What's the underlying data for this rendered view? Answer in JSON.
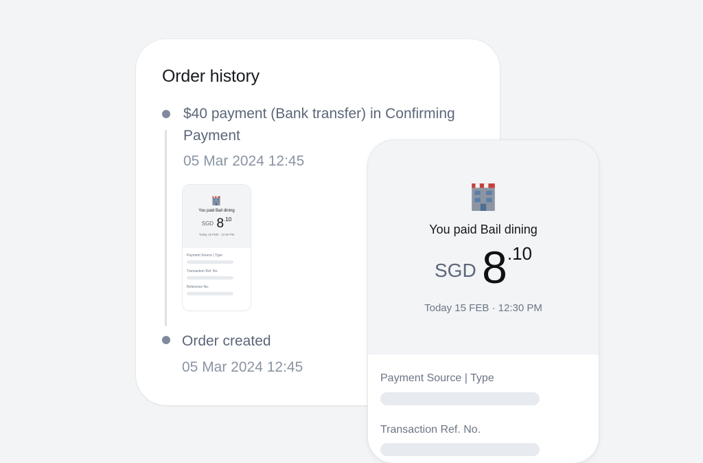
{
  "order_history": {
    "title": "Order history",
    "events": [
      {
        "title_line1": "$40 payment (Bank transfer) in Confirming",
        "title_line2": "Payment",
        "date": "05 Mar 2024 12:45"
      },
      {
        "title_line1": "Order created",
        "date": "05 Mar 2024 12:45"
      }
    ]
  },
  "receipt": {
    "merchant_icon": "office-building-icon",
    "paid_text": "You paid Bail dining",
    "currency": "SGD",
    "amount_whole": "8",
    "amount_decimal": ".10",
    "datetime": "Today 15 FEB · 12:30 PM",
    "fields": [
      "Payment Source | Type",
      "Transaction Ref. No.",
      "Reference No."
    ]
  },
  "colors": {
    "background": "#f2f4f6",
    "card": "#ffffff",
    "timeline_dot": "#7f8a9c",
    "placeholder_bar": "#e7eaee"
  }
}
